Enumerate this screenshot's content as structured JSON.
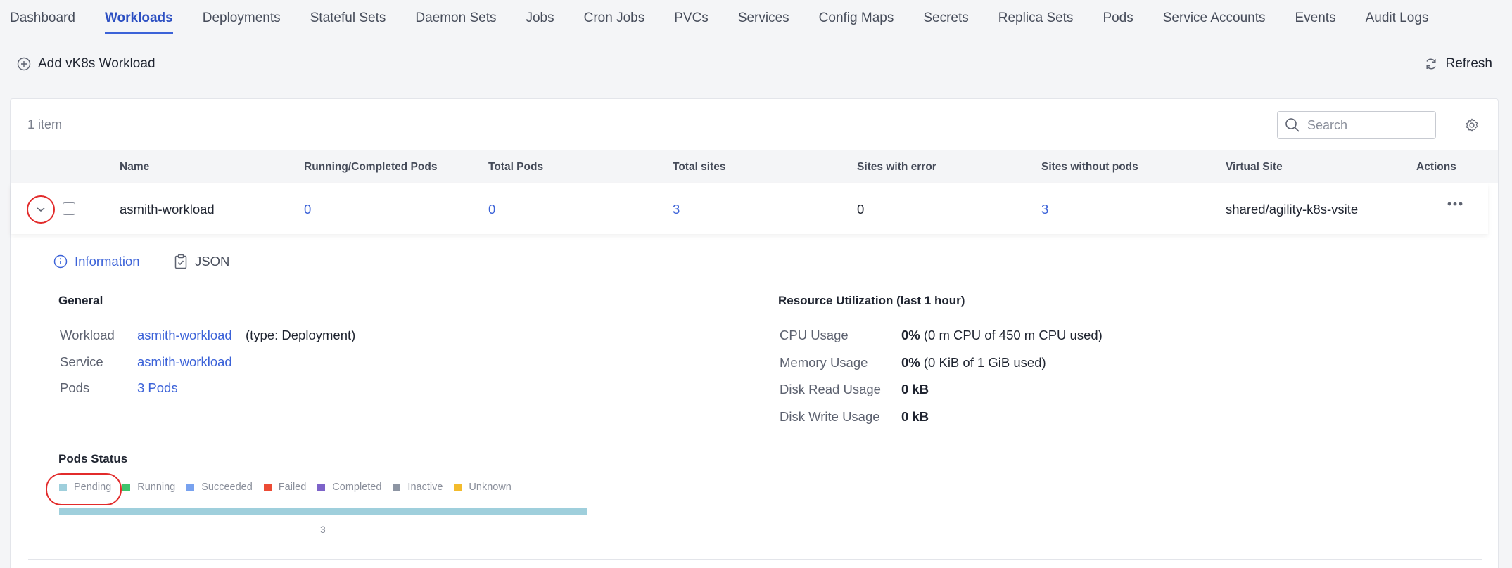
{
  "nav": {
    "tabs": [
      {
        "label": "Dashboard"
      },
      {
        "label": "Workloads"
      },
      {
        "label": "Deployments"
      },
      {
        "label": "Stateful Sets"
      },
      {
        "label": "Daemon Sets"
      },
      {
        "label": "Jobs"
      },
      {
        "label": "Cron Jobs"
      },
      {
        "label": "PVCs"
      },
      {
        "label": "Services"
      },
      {
        "label": "Config Maps"
      },
      {
        "label": "Secrets"
      },
      {
        "label": "Replica Sets"
      },
      {
        "label": "Pods"
      },
      {
        "label": "Service Accounts"
      },
      {
        "label": "Events"
      },
      {
        "label": "Audit Logs"
      }
    ],
    "active_tab": "Workloads"
  },
  "toolbar": {
    "add_label": "Add vK8s Workload",
    "refresh_label": "Refresh"
  },
  "table": {
    "item_count": "1 item",
    "search_placeholder": "Search",
    "columns": {
      "name": "Name",
      "running": "Running/Completed Pods",
      "total_pods": "Total Pods",
      "total_sites": "Total sites",
      "sites_error": "Sites with error",
      "sites_without": "Sites without pods",
      "virtual_site": "Virtual Site",
      "actions": "Actions"
    },
    "rows": [
      {
        "name": "asmith-workload",
        "running": "0",
        "total_pods": "0",
        "total_sites": "3",
        "sites_error": "0",
        "sites_without": "3",
        "virtual_site": "shared/agility-k8s-vsite"
      }
    ]
  },
  "detail": {
    "tabs": {
      "information": "Information",
      "json": "JSON"
    },
    "general": {
      "title": "General",
      "workload_label": "Workload",
      "workload_value": "asmith-workload",
      "workload_type": "(type: Deployment)",
      "service_label": "Service",
      "service_value": "asmith-workload",
      "pods_label": "Pods",
      "pods_value": "3 Pods"
    },
    "resources": {
      "title": "Resource Utilization (last 1 hour)",
      "cpu_label": "CPU Usage",
      "cpu_pct": "0%",
      "cpu_detail": "(0 m CPU of 450 m CPU used)",
      "mem_label": "Memory Usage",
      "mem_pct": "0%",
      "mem_detail": "(0 KiB of 1 GiB used)",
      "disk_read_label": "Disk Read Usage",
      "disk_read_value": "0 kB",
      "disk_write_label": "Disk Write Usage",
      "disk_write_value": "0 kB"
    },
    "pods_status": {
      "title": "Pods Status",
      "legend": [
        {
          "label": "Pending",
          "color": "#9fcfdc"
        },
        {
          "label": "Running",
          "color": "#3ec46d"
        },
        {
          "label": "Succeeded",
          "color": "#78a2ef"
        },
        {
          "label": "Failed",
          "color": "#ec4b35"
        },
        {
          "label": "Completed",
          "color": "#7d63c9"
        },
        {
          "label": "Inactive",
          "color": "#8d95a3"
        },
        {
          "label": "Unknown",
          "color": "#f3bb2c"
        }
      ],
      "bar": {
        "pending_count": "3",
        "pending_fraction": 1.0,
        "color": "#9fcfdc"
      }
    }
  }
}
